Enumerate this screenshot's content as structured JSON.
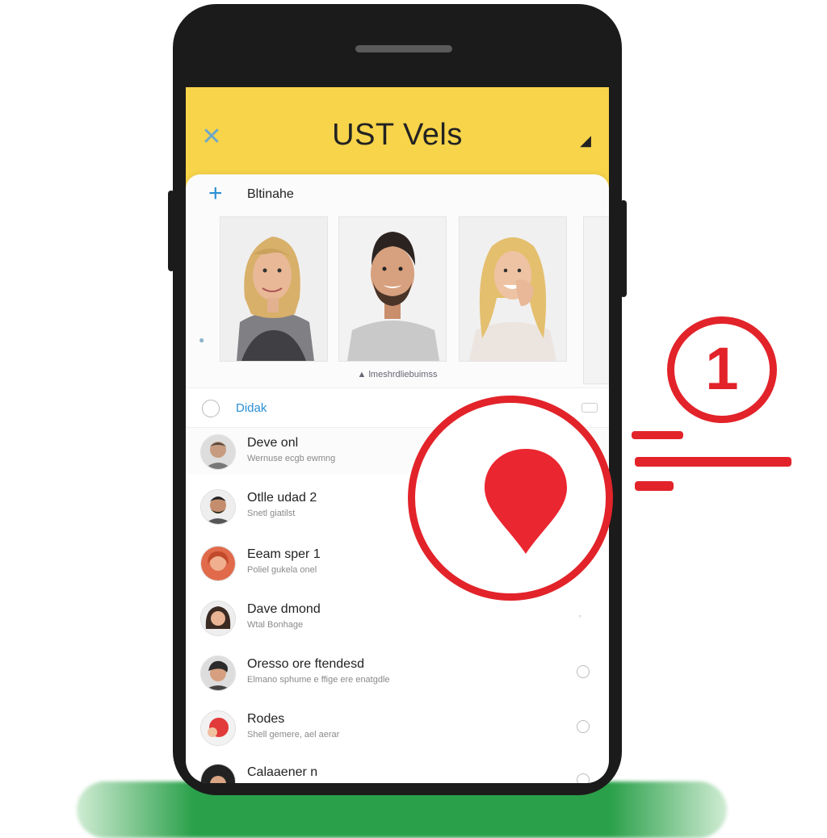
{
  "header": {
    "title": "UST Vels",
    "close_icon": "close-icon",
    "accent_color": "#f7d44a"
  },
  "stories": {
    "label": "Bltinahe",
    "caption": "▲ lmeshrdliebuimss"
  },
  "filter": {
    "label": "Didak"
  },
  "contacts": [
    {
      "name": "Deve onl",
      "sub": "Wernuse ecgb ewmng"
    },
    {
      "name": "Otlle udad 2",
      "sub": "Snetl giatilst"
    },
    {
      "name": "Eeam sper 1",
      "sub": "Poliel gukela onel"
    },
    {
      "name": "Dave dmond",
      "sub": "Wtal Bonhage"
    },
    {
      "name": "Oresso ore ftendesd",
      "sub": "Elmano sphume e ffige ere enatgdle"
    },
    {
      "name": "Rodes",
      "sub": "Shell gemere, ael aerar"
    },
    {
      "name": "Calaaener n",
      "sub": ""
    }
  ],
  "badge": {
    "number": "1"
  },
  "colors": {
    "highlight": "#e2232a",
    "link": "#2a8fd6"
  }
}
